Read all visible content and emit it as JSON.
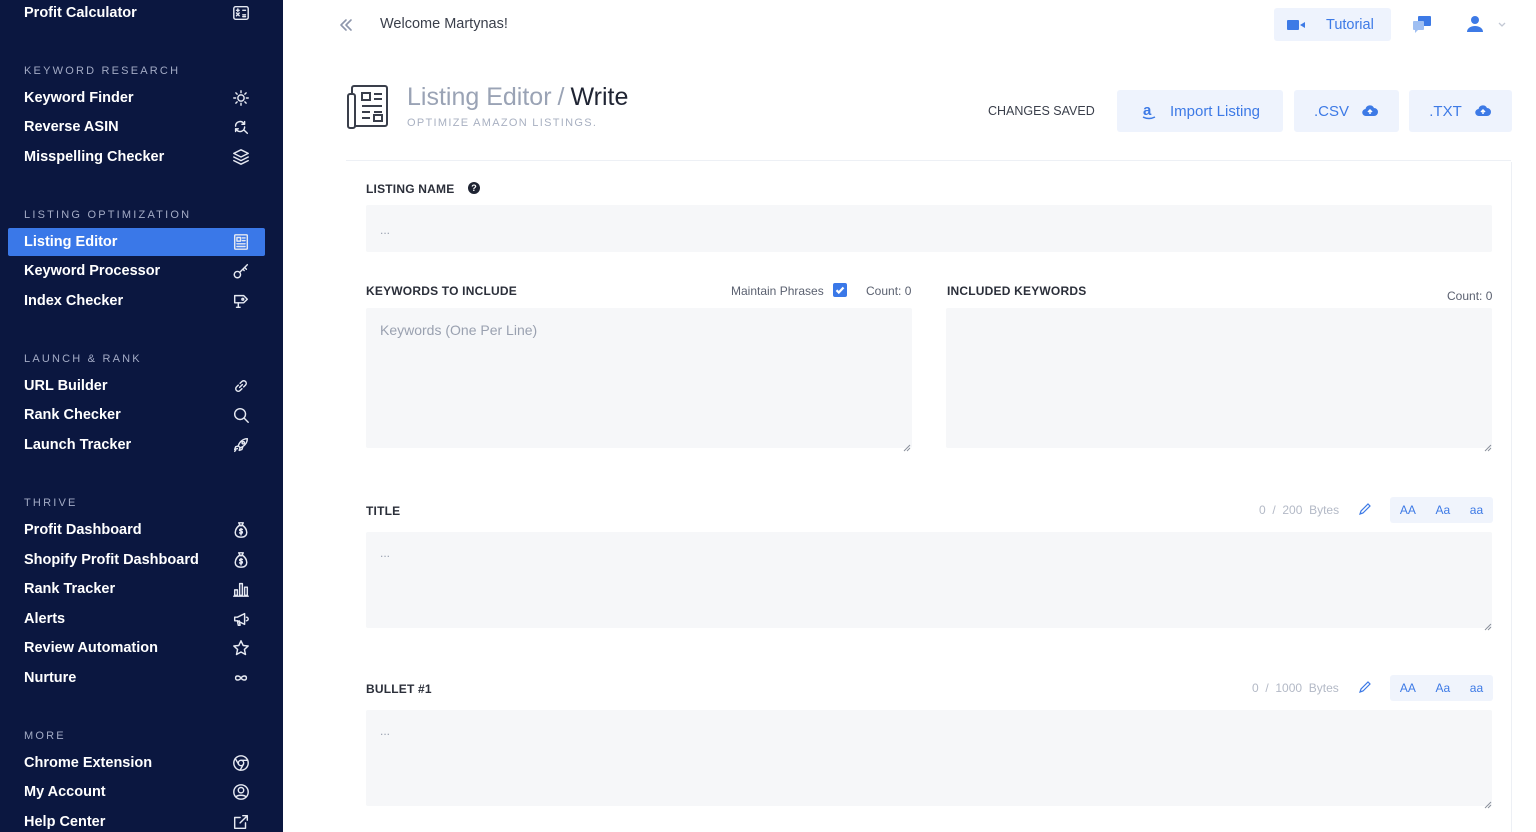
{
  "sidebar": {
    "top_item": {
      "label": "Profit Calculator",
      "icon": "calculator-icon"
    },
    "sections": [
      {
        "title": "KEYWORD RESEARCH",
        "items": [
          {
            "label": "Keyword Finder",
            "icon": "sun-icon"
          },
          {
            "label": "Reverse ASIN",
            "icon": "search-refresh-icon"
          },
          {
            "label": "Misspelling Checker",
            "icon": "layers-icon"
          }
        ]
      },
      {
        "title": "LISTING OPTIMIZATION",
        "items": [
          {
            "label": "Listing Editor",
            "icon": "document-icon",
            "active": true
          },
          {
            "label": "Keyword Processor",
            "icon": "key-icon"
          },
          {
            "label": "Index Checker",
            "icon": "tag-icon"
          }
        ]
      },
      {
        "title": "LAUNCH & RANK",
        "items": [
          {
            "label": "URL Builder",
            "icon": "link-icon"
          },
          {
            "label": "Rank Checker",
            "icon": "search-icon"
          },
          {
            "label": "Launch Tracker",
            "icon": "rocket-icon"
          }
        ]
      },
      {
        "title": "THRIVE",
        "items": [
          {
            "label": "Profit Dashboard",
            "icon": "money-bag-icon"
          },
          {
            "label": "Shopify Profit Dashboard",
            "icon": "money-bag-icon"
          },
          {
            "label": "Rank Tracker",
            "icon": "bar-chart-icon"
          },
          {
            "label": "Alerts",
            "icon": "megaphone-icon"
          },
          {
            "label": "Review Automation",
            "icon": "star-icon"
          },
          {
            "label": "Nurture",
            "icon": "infinity-icon"
          }
        ]
      },
      {
        "title": "MORE",
        "items": [
          {
            "label": "Chrome Extension",
            "icon": "chrome-icon"
          },
          {
            "label": "My Account",
            "icon": "user-circle-icon"
          },
          {
            "label": "Help Center",
            "icon": "external-link-icon"
          }
        ]
      }
    ]
  },
  "header": {
    "welcome": "Welcome Martynas!",
    "tutorial_label": "Tutorial"
  },
  "page": {
    "title_prefix": "Listing Editor",
    "title_sep": "/",
    "title_current": "Write",
    "subtitle": "OPTIMIZE AMAZON LISTINGS.",
    "status": "CHANGES SAVED",
    "import_label": "Import Listing",
    "csv_label": ".CSV",
    "txt_label": ".TXT"
  },
  "form": {
    "listing_name": {
      "label": "LISTING NAME",
      "placeholder": "..."
    },
    "keywords": {
      "label": "KEYWORDS TO INCLUDE",
      "maintain_label": "Maintain Phrases",
      "maintain_checked": true,
      "count": "Count: 0",
      "placeholder": "Keywords (One Per Line)"
    },
    "included": {
      "label": "INCLUDED KEYWORDS",
      "count": "Count: 0"
    },
    "title": {
      "label": "TITLE",
      "bytes_used": "0",
      "bytes_sep": "/",
      "bytes_max": "200",
      "bytes_unit": "Bytes",
      "placeholder": "..."
    },
    "bullet1": {
      "label": "BULLET #1",
      "bytes_used": "0",
      "bytes_sep": "/",
      "bytes_max": "1000",
      "bytes_unit": "Bytes",
      "placeholder": "..."
    },
    "case_buttons": [
      "AA",
      "Aa",
      "aa"
    ]
  },
  "colors": {
    "sidebar_bg": "#0b1740",
    "accent": "#3a78e8",
    "button_bg": "#eef3fd",
    "button_text": "#3d7ae6"
  }
}
